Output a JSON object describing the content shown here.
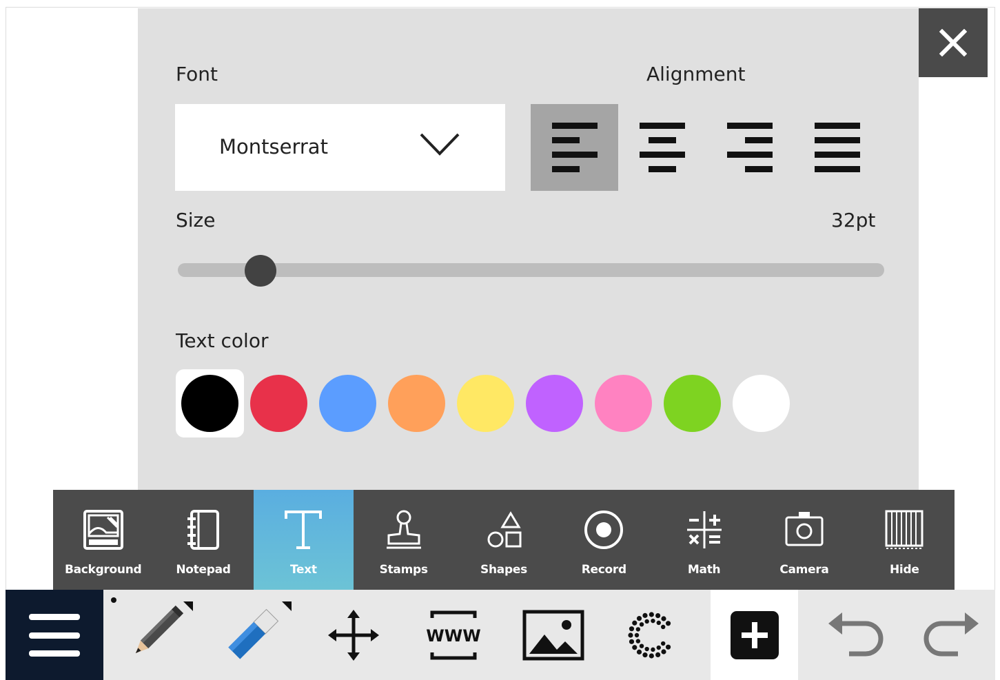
{
  "panel": {
    "font_label": "Font",
    "alignment_label": "Alignment",
    "font_value": "Montserrat",
    "alignment_options": [
      "left",
      "center",
      "right",
      "justify"
    ],
    "alignment_selected": "left",
    "size_label": "Size",
    "size_value": "32pt",
    "size_fraction": 0.117,
    "text_color_label": "Text color",
    "colors": [
      "#000000",
      "#e8314a",
      "#5b9dff",
      "#ffa05a",
      "#ffe864",
      "#c062ff",
      "#ff82c1",
      "#7ed321",
      "#ffffff"
    ],
    "selected_color": "#000000"
  },
  "close_icon": "close-icon",
  "toolbar": {
    "active": "Text",
    "active_color": "#5aaee0",
    "items": [
      {
        "label": "Background",
        "icon": "background-icon"
      },
      {
        "label": "Notepad",
        "icon": "notepad-icon"
      },
      {
        "label": "Text",
        "icon": "text-icon"
      },
      {
        "label": "Stamps",
        "icon": "stamp-icon"
      },
      {
        "label": "Shapes",
        "icon": "shapes-icon"
      },
      {
        "label": "Record",
        "icon": "record-icon"
      },
      {
        "label": "Math",
        "icon": "math-icon"
      },
      {
        "label": "Camera",
        "icon": "camera-icon"
      },
      {
        "label": "Hide",
        "icon": "hide-icon"
      }
    ]
  },
  "bottom_bar": {
    "items": [
      "menu-icon",
      "pencil-icon",
      "eraser-icon",
      "move-icon",
      "www-icon",
      "image-icon",
      "lasso-icon",
      "add-icon",
      "undo-icon",
      "redo-icon"
    ]
  }
}
